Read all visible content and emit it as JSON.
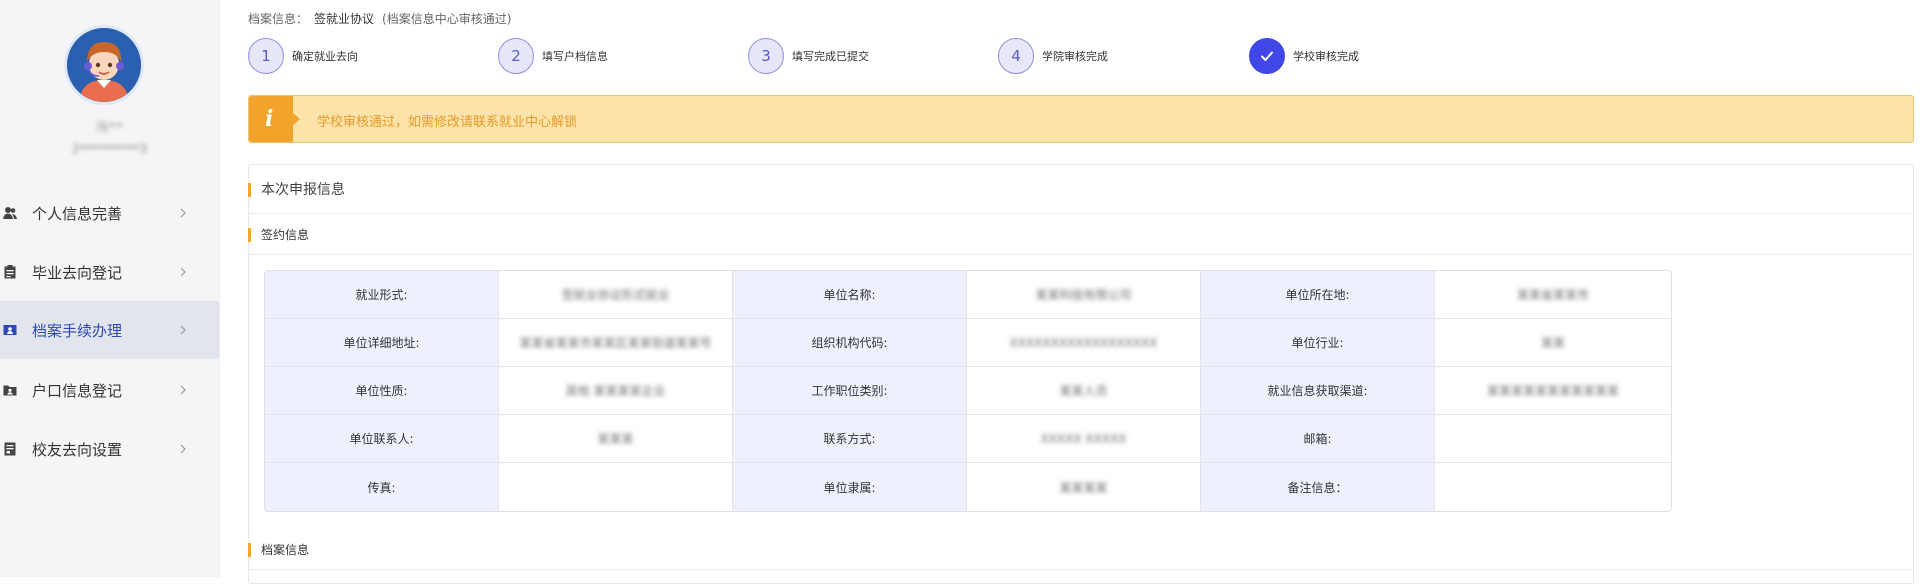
{
  "user": {
    "name": "冯**",
    "id": "2**********3"
  },
  "sidebar": {
    "items": [
      {
        "label": "个人信息完善",
        "icon": "person-icon",
        "active": false
      },
      {
        "label": "毕业去向登记",
        "icon": "clipboard-icon",
        "active": false
      },
      {
        "label": "档案手续办理",
        "icon": "id-card-icon",
        "active": true
      },
      {
        "label": "户口信息登记",
        "icon": "folder-user-icon",
        "active": false
      },
      {
        "label": "校友去向设置",
        "icon": "document-icon",
        "active": false
      }
    ]
  },
  "breadcrumb": {
    "label": "档案信息：",
    "value": "签就业协议",
    "note": "(档案信息中心审核通过)"
  },
  "steps": [
    {
      "number": "1",
      "label": "确定就业去向",
      "done": false
    },
    {
      "number": "2",
      "label": "填写户档信息",
      "done": false
    },
    {
      "number": "3",
      "label": "填写完成已提交",
      "done": false
    },
    {
      "number": "4",
      "label": "学院审核完成",
      "done": false
    },
    {
      "number": "",
      "label": "学校审核完成",
      "done": true
    }
  ],
  "alert": {
    "icon": "info-icon",
    "message": "学校审核通过，如需修改请联系就业中心解锁"
  },
  "sections": {
    "report_title": "本次申报信息",
    "sign_title": "签约信息",
    "archive_title": "档案信息"
  },
  "table": {
    "rows": [
      [
        {
          "label": "就业形式:",
          "value": "签就业协议形式就业"
        },
        {
          "label": "单位名称:",
          "value": "某某科技有限公司"
        },
        {
          "label": "单位所在地:",
          "value": "某某省某某市"
        }
      ],
      [
        {
          "label": "单位详细地址:",
          "value": "某某省某某市某某区某某街道某某号"
        },
        {
          "label": "组织机构代码:",
          "value": "XXXXXXXXXXXXXXXXXX"
        },
        {
          "label": "单位行业:",
          "value": "某某"
        }
      ],
      [
        {
          "label": "单位性质:",
          "value": "其他 某某某某企业"
        },
        {
          "label": "工作职位类别:",
          "value": "某某人员"
        },
        {
          "label": "就业信息获取渠道:",
          "value": "某某某某某某某某某某某"
        }
      ],
      [
        {
          "label": "单位联系人:",
          "value": "某某某"
        },
        {
          "label": "联系方式:",
          "value": "XXXXX XXXXX"
        },
        {
          "label": "邮箱:",
          "value": ""
        }
      ],
      [
        {
          "label": "传真:",
          "value": ""
        },
        {
          "label": "单位隶属:",
          "value": "某某某某"
        },
        {
          "label": "备注信息：",
          "value": ""
        }
      ]
    ]
  },
  "colors": {
    "accent": "#4147e6",
    "alert_bg": "#fce3a9",
    "alert_text": "#e39c2a",
    "section_marker": "#f5a623",
    "sidebar_active": "#e2e5ee"
  }
}
